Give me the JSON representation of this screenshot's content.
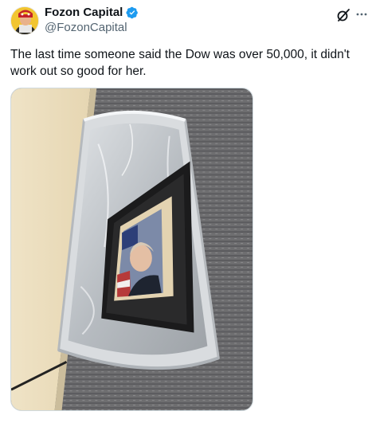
{
  "author": {
    "display_name": "Fozon Capital",
    "handle": "@FozonCapital",
    "verified": true,
    "verified_color": "#1d9bf0"
  },
  "tweet": {
    "text": "The last time someone said the Dow was over 50,000, it didn't work out so good for her."
  },
  "icons": {
    "grok": "grok-icon",
    "more": "more-icon",
    "verified": "verified-badge-icon"
  },
  "colors": {
    "text_primary": "#0f1419",
    "text_secondary": "#536471",
    "border": "#cfd9de"
  }
}
